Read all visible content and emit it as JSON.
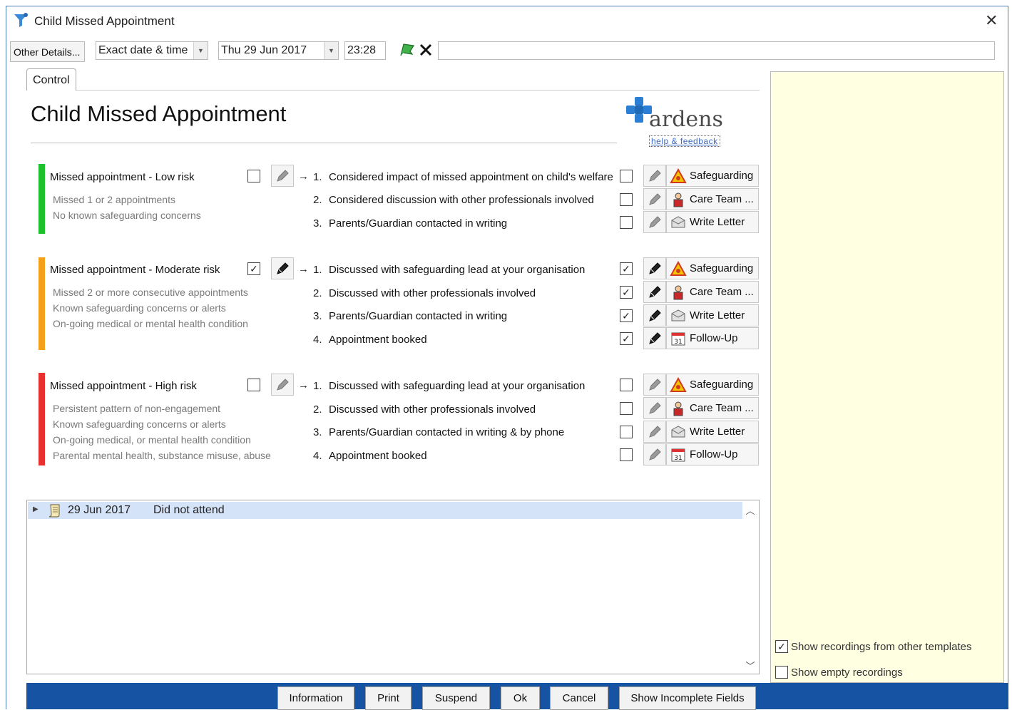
{
  "window": {
    "title": "Child Missed Appointment",
    "close_icon": "close-icon"
  },
  "toolbar": {
    "other_details_label": "Other Details...",
    "date_mode": "Exact date & time",
    "date_value": "Thu 29 Jun 2017",
    "time_value": "23:28",
    "note_value": ""
  },
  "tab": {
    "label": "Control"
  },
  "form": {
    "title": "Child Missed Appointment",
    "logo_text": "ardens",
    "help_link": "help & feedback"
  },
  "risk_groups": [
    {
      "title": "Missed appointment - Low risk",
      "color": "#1dc12b",
      "checked": false,
      "descriptions": [
        "Missed 1 or 2 appointments",
        "No known safeguarding concerns"
      ],
      "items": [
        {
          "num": "1.",
          "text": "Considered impact of missed appointment on child's welfare",
          "checked": false,
          "action": "Safeguarding",
          "icon": "safeguarding-icon"
        },
        {
          "num": "2.",
          "text": "Considered discussion with other professionals involved",
          "checked": false,
          "action": "Care Team ...",
          "icon": "care-team-icon"
        },
        {
          "num": "3.",
          "text": "Parents/Guardian contacted in writing",
          "checked": false,
          "action": "Write Letter",
          "icon": "write-letter-icon"
        }
      ]
    },
    {
      "title": "Missed appointment - Moderate risk",
      "color": "#f5a01a",
      "checked": true,
      "descriptions": [
        "Missed 2 or more consecutive appointments",
        "Known safeguarding concerns or alerts",
        "On-going medical or mental health condition"
      ],
      "items": [
        {
          "num": "1.",
          "text": "Discussed with safeguarding lead at your organisation",
          "checked": true,
          "action": "Safeguarding",
          "icon": "safeguarding-icon"
        },
        {
          "num": "2.",
          "text": "Discussed with other professionals involved",
          "checked": true,
          "action": "Care Team ...",
          "icon": "care-team-icon"
        },
        {
          "num": "3.",
          "text": "Parents/Guardian contacted in writing",
          "checked": true,
          "action": "Write Letter",
          "icon": "write-letter-icon"
        },
        {
          "num": "4.",
          "text": "Appointment booked",
          "checked": true,
          "action": "Follow-Up",
          "icon": "calendar-icon"
        }
      ]
    },
    {
      "title": "Missed appointment - High risk",
      "color": "#e8312f",
      "checked": false,
      "descriptions": [
        "Persistent pattern of non-engagement",
        "Known safeguarding concerns or alerts",
        "On-going medical, or mental health condition",
        "Parental mental health, substance misuse, abuse"
      ],
      "items": [
        {
          "num": "1.",
          "text": "Discussed with safeguarding lead at your organisation",
          "checked": false,
          "action": "Safeguarding",
          "icon": "safeguarding-icon"
        },
        {
          "num": "2.",
          "text": "Discussed with other professionals involved",
          "checked": false,
          "action": "Care Team ...",
          "icon": "care-team-icon"
        },
        {
          "num": "3.",
          "text": "Parents/Guardian contacted in writing & by phone",
          "checked": false,
          "action": "Write Letter",
          "icon": "write-letter-icon"
        },
        {
          "num": "4.",
          "text": "Appointment booked",
          "checked": false,
          "action": "Follow-Up",
          "icon": "calendar-icon"
        }
      ]
    }
  ],
  "history": {
    "rows": [
      {
        "date": "29 Jun 2017",
        "text": "Did not attend"
      }
    ]
  },
  "options": {
    "show_other_templates": {
      "label": "Show recordings from other templates",
      "checked": true
    },
    "show_empty": {
      "label": "Show empty recordings",
      "checked": false
    }
  },
  "buttons": {
    "information": "Information",
    "print": "Print",
    "suspend": "Suspend",
    "ok": "Ok",
    "cancel": "Cancel",
    "show_incomplete": "Show Incomplete Fields"
  }
}
